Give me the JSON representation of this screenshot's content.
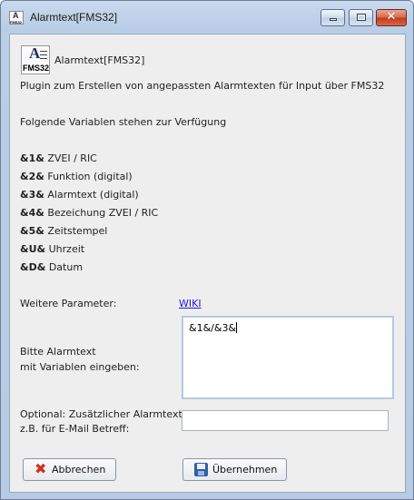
{
  "window": {
    "title": "Alarmtext[FMS32]",
    "icon": "fms32-app-icon",
    "controls": [
      "minimize",
      "maximize",
      "close"
    ]
  },
  "header": {
    "icon_letter": "A",
    "icon_caption": "FMS32",
    "plugin_name": "Alarmtext[FMS32]",
    "description": "Plugin zum Erstellen von angepassten Alarmtexten für Input über FMS32"
  },
  "variables": {
    "intro": "Folgende Variablen stehen zur Verfügung",
    "items": [
      {
        "code": "&1&",
        "label": "ZVEI / RIC"
      },
      {
        "code": "&2&",
        "label": "Funktion (digital)"
      },
      {
        "code": "&3&",
        "label": "Alarmtext (digital)"
      },
      {
        "code": "&4&",
        "label": "Bezeichung ZVEI / RIC"
      },
      {
        "code": "&5&",
        "label": "Zeitstempel"
      },
      {
        "code": "&U&",
        "label": "Uhrzeit"
      },
      {
        "code": "&D&",
        "label": "Datum"
      }
    ]
  },
  "params": {
    "label": "Weitere Parameter:",
    "link": "WIKI"
  },
  "alarmtext": {
    "label_line1": "Bitte Alarmtext",
    "label_line2": "mit Variablen eingeben:",
    "value": "&1&/&3&"
  },
  "subject": {
    "label_line1": "Optional: Zusätzlicher Alarmtext",
    "label_line2": "z.B. für E-Mail Betreff:",
    "value": ""
  },
  "buttons": {
    "cancel": "Abbrechen",
    "apply": "Übernehmen"
  }
}
